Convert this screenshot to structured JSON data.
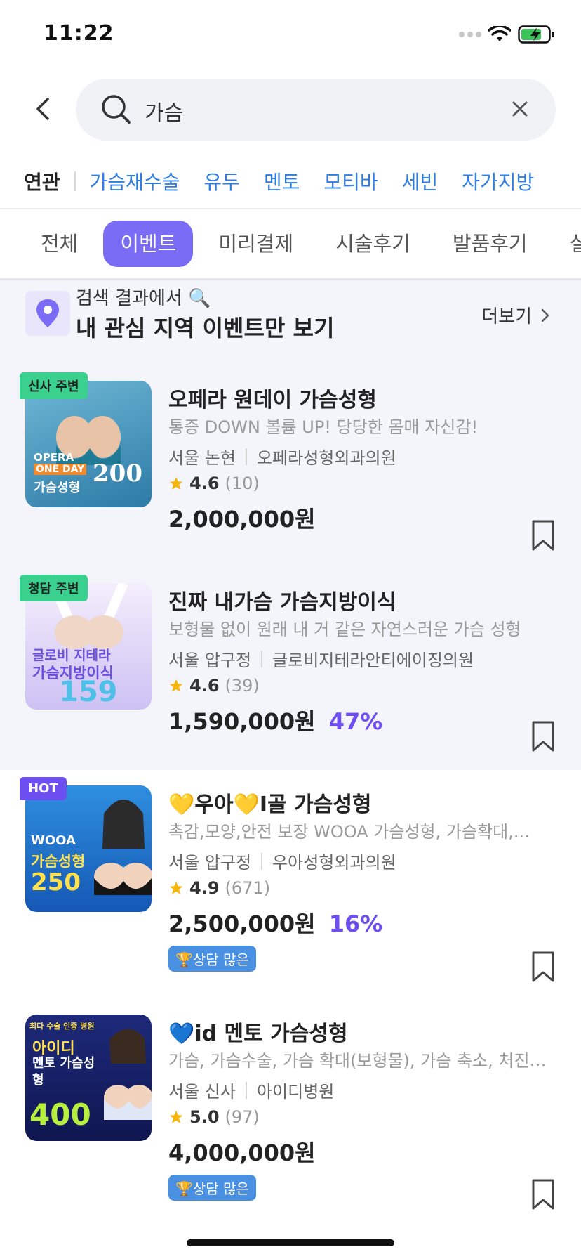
{
  "status_bar": {
    "time": "11:22"
  },
  "search": {
    "query": "가슴"
  },
  "related": {
    "title": "연관",
    "items": [
      "가슴재수술",
      "유두",
      "멘토",
      "모티바",
      "세빈",
      "자가지방"
    ]
  },
  "tabs": [
    "전체",
    "이벤트",
    "미리결제",
    "시술후기",
    "발품후기",
    "실결"
  ],
  "active_tab": "이벤트",
  "location_banner": {
    "subtitle": "검색 결과에서 🔍",
    "title": "내 관심 지역 이벤트만 보기",
    "more": "더보기"
  },
  "events": [
    {
      "badge": "신사 주변",
      "title": "오페라 원데이 가슴성형",
      "desc": "통증 DOWN 볼륨 UP! 당당한 몸매 자신감!",
      "area": "서울 논현",
      "clinic": "오페라성형외과의원",
      "rating": "4.6",
      "reviews": "(10)",
      "price": "2,000,000원",
      "discount": "",
      "tag": "",
      "thumb": {
        "line1": "OPERA",
        "line2": "ONE DAY",
        "line3": "가슴성형",
        "num": "200"
      }
    },
    {
      "badge": "청담 주변",
      "title": "진짜 내가슴 가슴지방이식",
      "desc": "보형물 없이 원래 내 거 같은 자연스러운 가슴 성형",
      "area": "서울 압구정",
      "clinic": "글로비지테라안티에이징의원",
      "rating": "4.6",
      "reviews": "(39)",
      "price": "1,590,000원",
      "discount": "47%",
      "tag": "",
      "thumb": {
        "line1": "글로비 지테라",
        "line2": "가슴지방이식",
        "line3": "",
        "num": "159"
      }
    },
    {
      "badge": "HOT",
      "title": "💛우아💛I골 가슴성형",
      "desc": "촉감,모양,안전 보장 WOOA 가슴성형, 가슴확대,...",
      "area": "서울 압구정",
      "clinic": "우아성형외과의원",
      "rating": "4.9",
      "reviews": "(671)",
      "price": "2,500,000원",
      "discount": "16%",
      "tag": "🏆상담 많은",
      "thumb": {
        "line1": "WOOA",
        "line2": "가슴성형",
        "line3": "",
        "num": "250"
      }
    },
    {
      "badge": "",
      "title": "💙id 멘토 가슴성형",
      "desc": "가슴, 가슴수술, 가슴 확대(보형물), 가슴 축소, 처진…",
      "area": "서울 신사",
      "clinic": "아이디병원",
      "rating": "5.0",
      "reviews": "(97)",
      "price": "4,000,000원",
      "discount": "",
      "tag": "🏆상담 많은",
      "thumb": {
        "line1": "최다 수술 인증 병원",
        "line2": "아이디",
        "line3": "멘토 가슴성형",
        "num": "400"
      }
    }
  ],
  "colors": {
    "accent": "#7b6cf6",
    "link": "#2f7de1",
    "discount": "#6d4ef0",
    "badge_green": "#3ad08e",
    "tag_blue": "#4a90e2"
  }
}
